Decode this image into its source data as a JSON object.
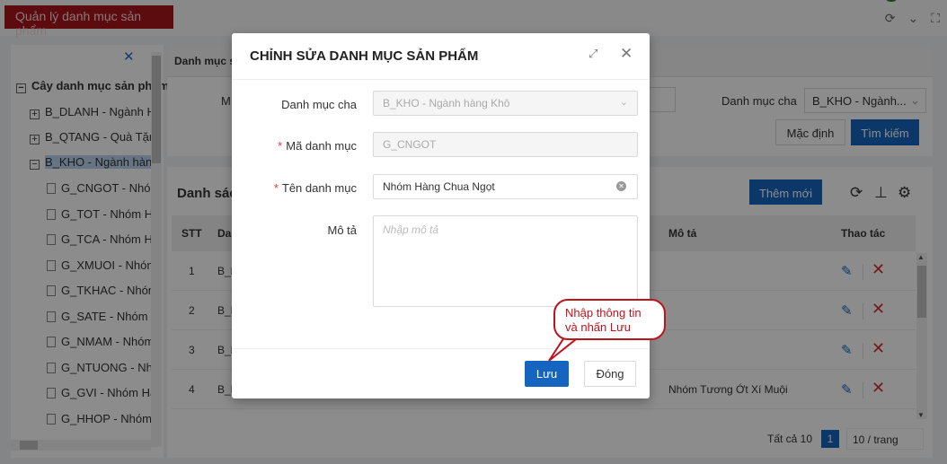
{
  "top": {
    "tab_label": "Quản lý danh mục sản phẩm"
  },
  "tree": {
    "root": "Cây danh mục sản phẩm",
    "items": [
      "B_DLANH - Ngành H",
      "B_QTANG - Quà Tặng",
      "B_KHO - Ngành hàng"
    ],
    "children": [
      "G_CNGOT - Nhóm",
      "G_TOT - Nhóm Hà",
      "G_TCA - Nhóm Hà",
      "G_XMUOI - Nhóm",
      "G_TKHAC - Nhóm",
      "G_SATE - Nhóm H",
      "G_NMAM - Nhóm",
      "G_NTUONG - Nhó",
      "G_GVI - Nhóm Hà",
      "G_HHOP - Nhóm"
    ]
  },
  "search": {
    "header": "Danh mục s",
    "m_label": "M",
    "dm_label": "Danh mục cha",
    "dm_value": "B_KHO - Ngành...",
    "default_btn": "Mặc định",
    "search_btn": "Tìm kiếm"
  },
  "list": {
    "title": "Danh sác",
    "add_btn": "Thêm mới",
    "columns": {
      "stt": "STT",
      "code": "Da",
      "desc": "Mô tả",
      "actions": "Thao tác"
    },
    "rows": [
      {
        "stt": "1",
        "code": "B_K",
        "desc": ""
      },
      {
        "stt": "2",
        "code": "B_K",
        "desc": ""
      },
      {
        "stt": "3",
        "code": "B_K",
        "desc": ""
      },
      {
        "stt": "4",
        "code": "B_K",
        "desc": "Nhóm Tương Ớt Xí Muội"
      }
    ],
    "pager": {
      "total": "Tất cả 10",
      "page": "1",
      "size": "10 / trang"
    }
  },
  "modal": {
    "title": "CHỈNH SỬA DANH MỤC SẢN PHẨM",
    "fields": {
      "parent_label": "Danh mục cha",
      "parent_value": "B_KHO - Ngành hàng Khô",
      "code_label": "Mã danh mục",
      "code_value": "G_CNGOT",
      "name_label": "Tên danh mục",
      "name_value": "Nhóm Hàng Chua Ngọt",
      "desc_label": "Mô tả",
      "desc_placeholder": "Nhập mô tả"
    },
    "save_btn": "Lưu",
    "close_btn": "Đóng"
  },
  "callout": {
    "line1": "Nhập thông tin",
    "line2": "và nhấn Lưu"
  },
  "colors": {
    "brand": "#a8151b",
    "primary": "#1565c0",
    "danger": "#d32f2f"
  }
}
